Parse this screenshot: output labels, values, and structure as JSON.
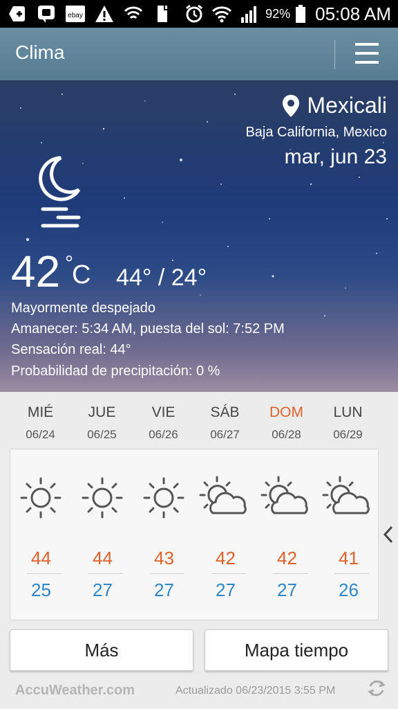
{
  "status_bar": {
    "battery": "92%",
    "time": "05:08 AM",
    "icons": [
      "add-icon",
      "bbm-icon",
      "ebay-icon",
      "warning-icon",
      "wifi-alert-icon",
      "sim-icon",
      "alarm-icon",
      "wifi-icon",
      "signal-icon",
      "battery-icon"
    ],
    "ebay_label": "ebay"
  },
  "app_bar": {
    "title": "Clima",
    "menu_icon": "hamburger-menu-icon"
  },
  "current": {
    "city": "Mexicali",
    "region": "Baja California, Mexico",
    "date": "mar, jun 23",
    "temp": "42",
    "degree": "°",
    "unit": "C",
    "hi_lo": "44° / 24°",
    "condition": "Mayormente despejado",
    "sun": "Amanecer: 5:34  AM, puesta del sol: 7:52  PM",
    "feels_like": "Sensación real: 44°",
    "precip": "Probabilidad de precipitación: 0 %",
    "icon": "moon-haze-icon"
  },
  "forecast": [
    {
      "day": "MIÉ",
      "date": "06/24",
      "hi": "44",
      "lo": "25",
      "icon": "sun-icon"
    },
    {
      "day": "JUE",
      "date": "06/25",
      "hi": "44",
      "lo": "27",
      "icon": "sun-icon"
    },
    {
      "day": "VIE",
      "date": "06/26",
      "hi": "43",
      "lo": "27",
      "icon": "sun-icon"
    },
    {
      "day": "SÁB",
      "date": "06/27",
      "hi": "42",
      "lo": "27",
      "icon": "partly-cloudy-icon"
    },
    {
      "day": "DOM",
      "date": "06/28",
      "hi": "42",
      "lo": "27",
      "icon": "partly-cloudy-icon"
    },
    {
      "day": "LUN",
      "date": "06/29",
      "hi": "41",
      "lo": "26",
      "icon": "partly-cloudy-icon"
    }
  ],
  "buttons": {
    "more": "Más",
    "map": "Mapa tiempo"
  },
  "footer": {
    "brand": "AccuWeather.com",
    "updated": "Actualizado 06/23/2015 3:55 PM"
  },
  "colors": {
    "weekend": "#e0602a",
    "hi": "#e0602a",
    "lo": "#2f86c8",
    "app_bar": "#5f8399"
  }
}
